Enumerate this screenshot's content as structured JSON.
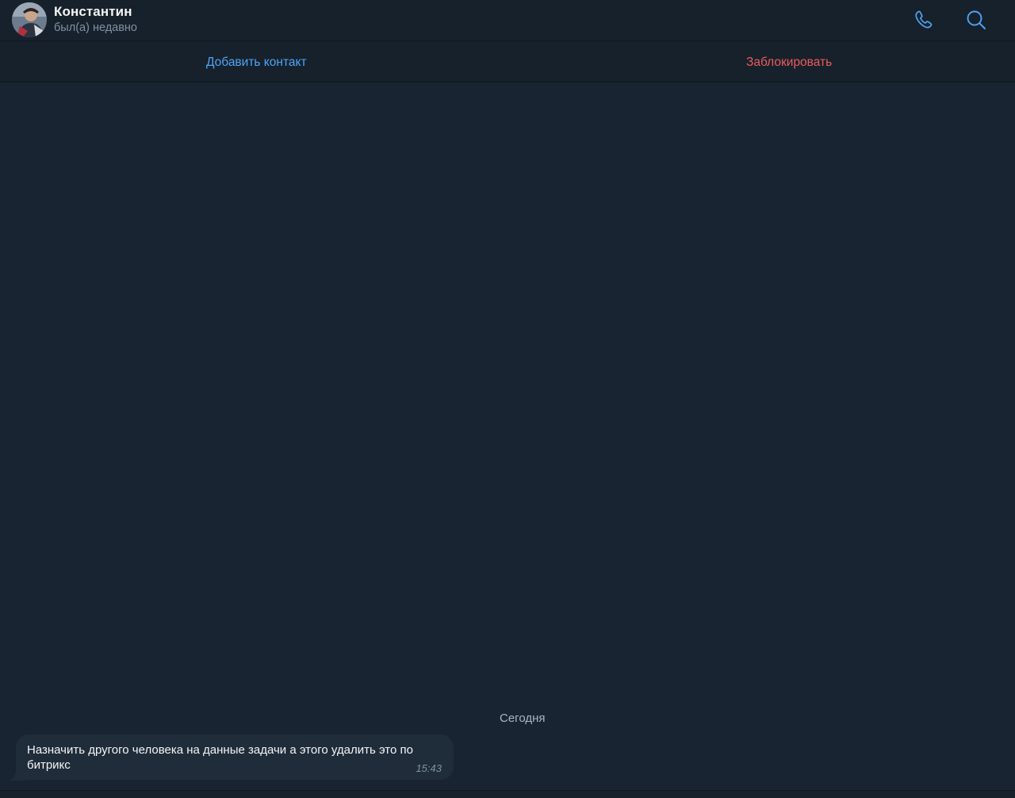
{
  "header": {
    "contact_name": "Константин",
    "status": "был(а) недавно",
    "icons": [
      "avatar",
      "phone-icon",
      "search-icon"
    ]
  },
  "action_bar": {
    "add_contact_label": "Добавить контакт",
    "block_label": "Заблокировать"
  },
  "chat": {
    "date_separator": "Сегодня",
    "messages": [
      {
        "text": "Назначить другого человека на данные задачи а этого удалить это по битрикс",
        "time": "15:43"
      }
    ]
  },
  "colors": {
    "background": "#17212b",
    "chat_background": "#182431",
    "bubble": "#1f2c3a",
    "accent": "#4ea4f6",
    "danger": "#ec5b5b",
    "muted_text": "#7f91a4"
  }
}
